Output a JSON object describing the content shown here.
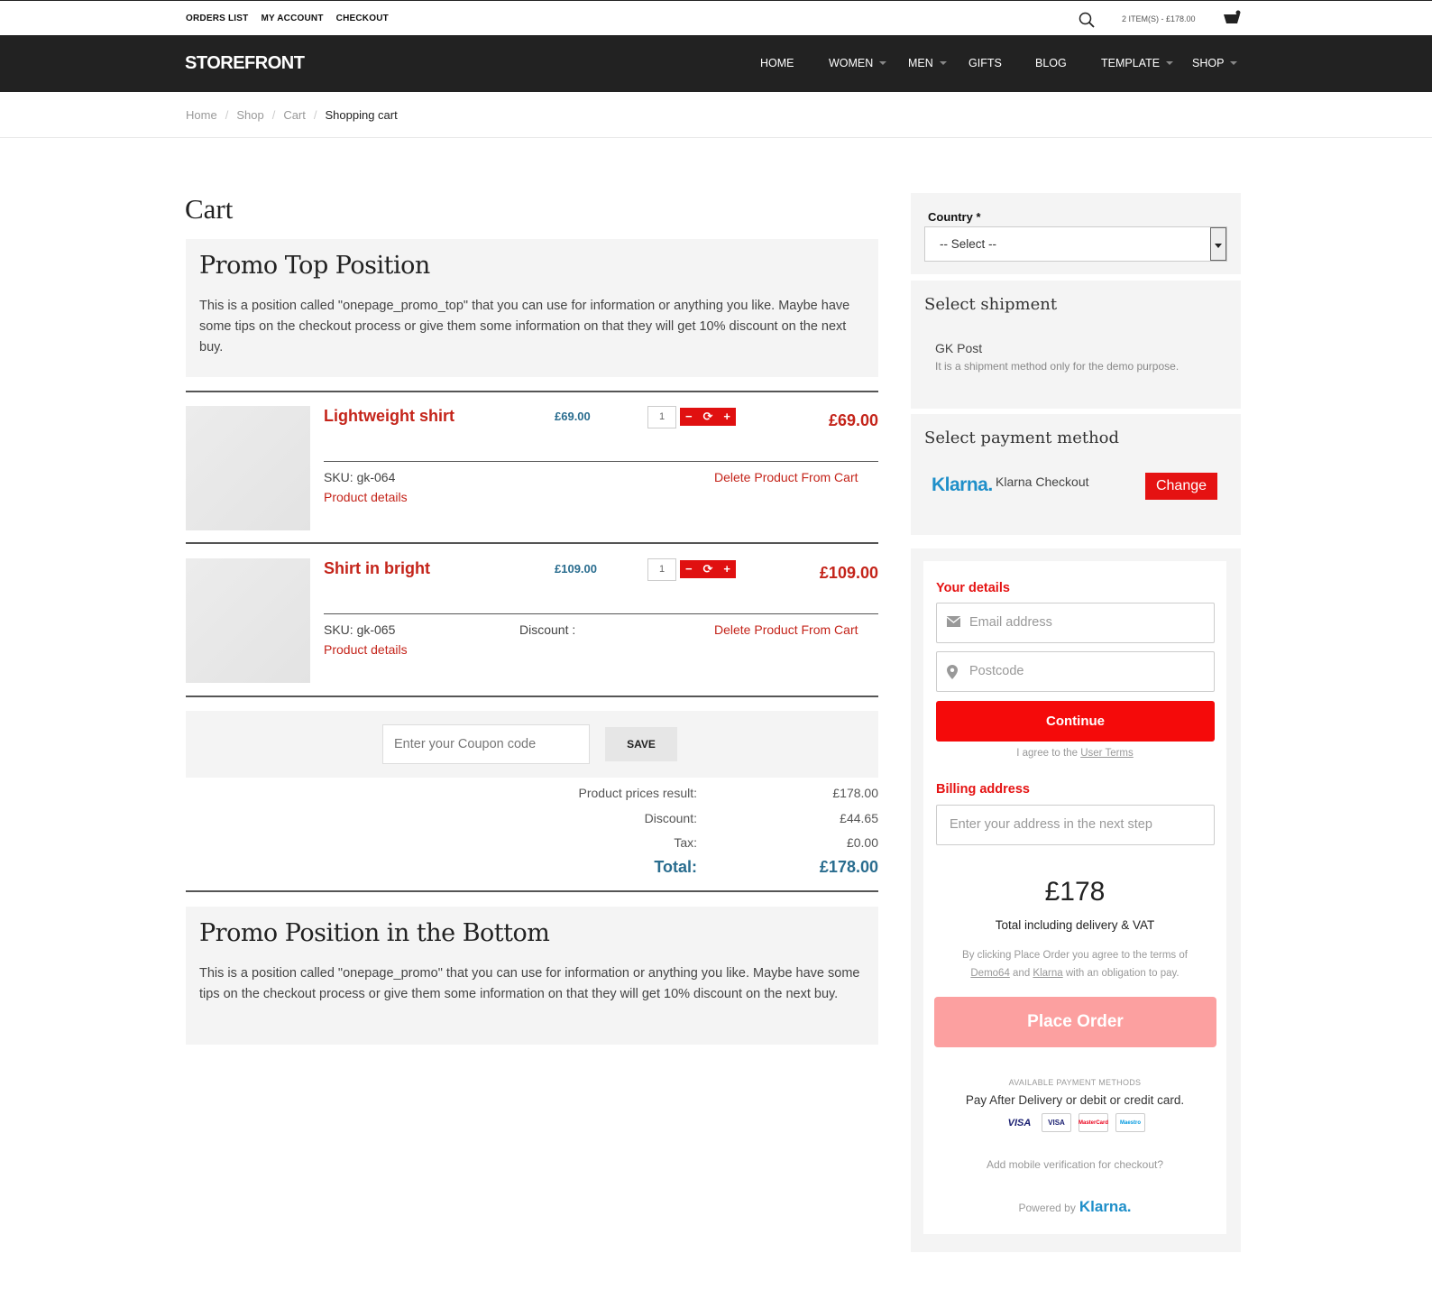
{
  "topbar": {
    "links": [
      "ORDERS LIST",
      "MY ACCOUNT",
      "CHECKOUT"
    ],
    "cart_summary": "2 ITEM(S) - £178.00"
  },
  "nav": {
    "logo": "STOREFRONT",
    "items": [
      {
        "label": "HOME",
        "has_caret": false
      },
      {
        "label": "WOMEN",
        "has_caret": true
      },
      {
        "label": "MEN",
        "has_caret": true
      },
      {
        "label": "GIFTS",
        "has_caret": false
      },
      {
        "label": "BLOG",
        "has_caret": false
      },
      {
        "label": "TEMPLATE",
        "has_caret": true
      },
      {
        "label": "SHOP",
        "has_caret": true
      }
    ]
  },
  "breadcrumb": [
    "Home",
    "Shop",
    "Cart",
    "Shopping cart"
  ],
  "page_title": "Cart",
  "promo_top": {
    "title": "Promo Top Position",
    "text": "This is a position called \"onepage_promo_top\" that you can use for information or anything you like. Maybe have some tips on the checkout process or give them some information on that they will get 10% discount on the next buy."
  },
  "products": [
    {
      "name": "Lightweight shirt",
      "price": "£69.00",
      "qty": "1",
      "total": "£69.00",
      "sku": "SKU: gk-064",
      "discount": "",
      "delete": "Delete Product From Cart",
      "details": "Product details"
    },
    {
      "name": "Shirt in bright",
      "price": "£109.00",
      "qty": "1",
      "total": "£109.00",
      "sku": "SKU: gk-065",
      "discount": "Discount :",
      "delete": "Delete Product From Cart",
      "details": "Product details"
    }
  ],
  "qty_buttons": {
    "minus": "−",
    "refresh": "⟳",
    "plus": "+"
  },
  "coupon": {
    "placeholder": "Enter your Coupon code",
    "save": "SAVE"
  },
  "summary": {
    "prices_label": "Product prices result:",
    "prices_value": "£178.00",
    "discount_label": "Discount:",
    "discount_value": "£44.65",
    "tax_label": "Tax:",
    "tax_value": "£0.00",
    "total_label": "Total:",
    "total_value": "£178.00"
  },
  "promo_bottom": {
    "title": "Promo Position in the Bottom",
    "text": "This is a position called \"onepage_promo\" that you can use for information or anything you like. Maybe have some tips on the checkout process or give them some information on that they will get 10% discount on the next buy."
  },
  "country": {
    "label": "Country *",
    "selected": "-- Select --"
  },
  "shipment": {
    "heading": "Select shipment",
    "name": "GK Post",
    "desc": "It is a shipment method only for the demo purpose."
  },
  "payment": {
    "heading": "Select payment method",
    "logo": "Klarna.",
    "name": "Klarna Checkout",
    "change": "Change"
  },
  "klarna": {
    "your_details": "Your details",
    "email_placeholder": "Email address",
    "postcode_placeholder": "Postcode",
    "continue": "Continue",
    "agree_prefix": "I agree to the ",
    "agree_link": "User Terms",
    "billing_label": "Billing address",
    "billing_placeholder": "Enter your address in the next step",
    "total": "£178",
    "total_caption": "Total including delivery & VAT",
    "terms_1": "By clicking Place Order you agree to the terms of",
    "terms_link1": "Demo64",
    "terms_and": " and ",
    "terms_link2": "Klarna",
    "terms_2": " with an obligation to pay.",
    "place_order": "Place Order",
    "available_heading": "AVAILABLE PAYMENT METHODS",
    "available_text": "Pay After Delivery or debit or credit card.",
    "cards": [
      "VISA",
      "VISA",
      "MasterCard",
      "Maestro"
    ],
    "mobile": "Add mobile verification for checkout?",
    "powered_by": "Powered by",
    "powered_logo": "Klarna."
  },
  "colors": {
    "accent_red": "#e51212",
    "price_blue": "#2a6d8f",
    "nav_bg": "#222222",
    "place_order_disabled": "#fca0a0",
    "klarna_blue": "#1f8fc9"
  }
}
